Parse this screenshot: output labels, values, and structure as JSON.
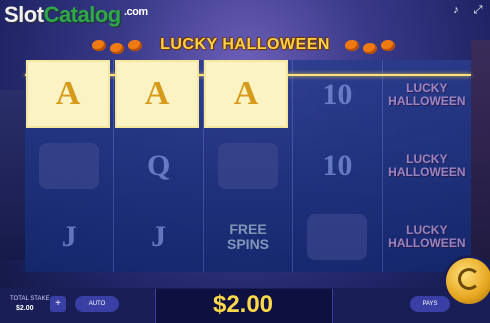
{
  "watermark": {
    "slot": "Slot",
    "catalog": "Catalog",
    "com": ".com"
  },
  "banner": {
    "title": "LUCKY HALLOWEEN"
  },
  "top_icons": [
    "speaker-icon",
    "fullscreen-icon"
  ],
  "reels": {
    "winning_symbols": [
      "A",
      "A",
      "A"
    ],
    "reel4": [
      "10",
      "10",
      ""
    ],
    "reel2_letters": [
      "Q",
      "J"
    ],
    "reel5_logos": [
      "LUCKY\nHALLOWEEN",
      "LUCKY\nHALLOWEEN",
      "LUCKY\nHALLOWEEN"
    ],
    "free_spins": "FREE\nSPINS",
    "reel1_letter": "J"
  },
  "footer": {
    "total_stake_label": "TOTAL STAKE",
    "total_stake_value": "$2.00",
    "plus_label": "+",
    "auto_label": "AUTO",
    "win_amount": "$2.00",
    "pays_label": "PAYS"
  },
  "colors": {
    "accent": "#ffd94a",
    "win_cell": "#fbf3c4",
    "panel": "#1a1e57"
  }
}
